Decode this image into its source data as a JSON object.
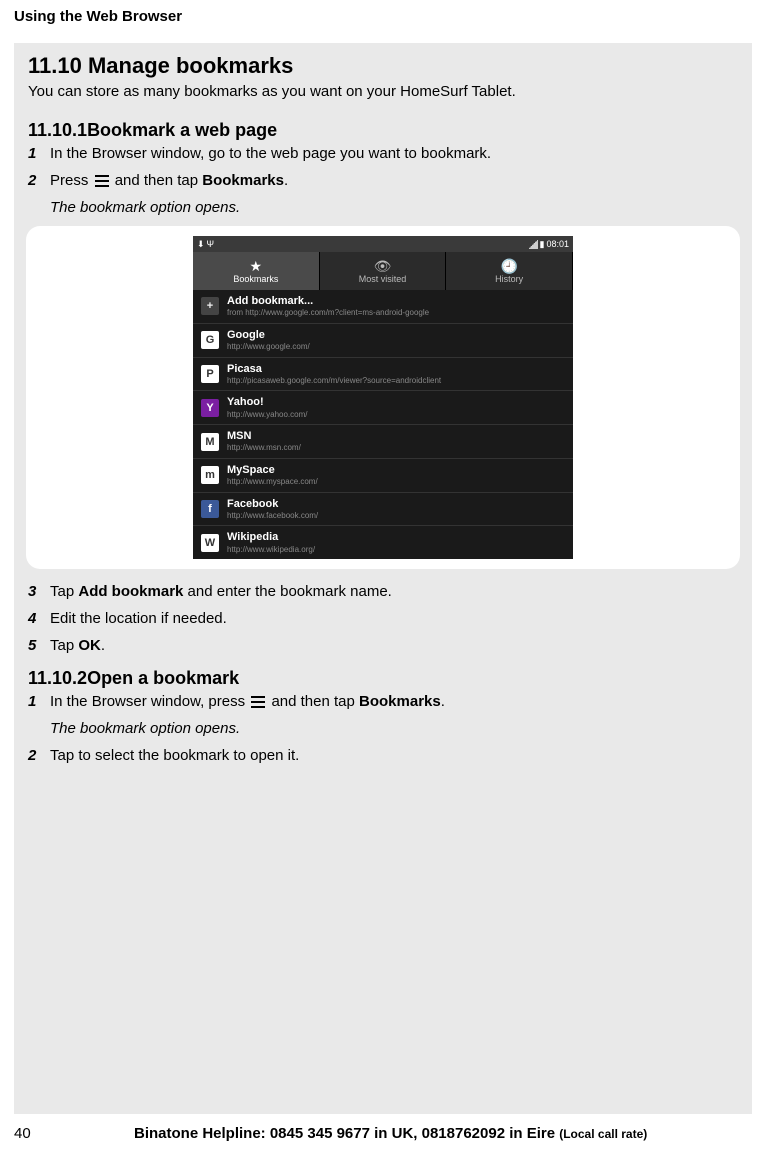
{
  "page_header": "Using the Web Browser",
  "section": {
    "number": "11.10",
    "title": "Manage bookmarks",
    "intro": "You can store as many bookmarks as you want on your HomeSurf Tablet."
  },
  "sub1": {
    "number": "11.10.1",
    "title": "Bookmark a web page",
    "steps": [
      {
        "num": "1",
        "text": "In the Browser window, go to the web page you want to bookmark."
      },
      {
        "num": "2",
        "pre": "Press ",
        "post": " and then tap ",
        "bold": "Bookmarks",
        "end": "."
      },
      {
        "num": "3",
        "pre": "Tap ",
        "bold": "Add bookmark",
        "post": " and enter the bookmark name."
      },
      {
        "num": "4",
        "text": "Edit the location if needed."
      },
      {
        "num": "5",
        "pre": "Tap ",
        "bold": "OK",
        "post": "."
      }
    ],
    "result": "The bookmark option opens."
  },
  "sub2": {
    "number": "11.10.2",
    "title": "Open a bookmark",
    "steps": [
      {
        "num": "1",
        "pre": "In the Browser window, press ",
        "post": " and then tap ",
        "bold": "Bookmarks",
        "end": "."
      },
      {
        "num": "2",
        "text": "Tap to select the bookmark to open it."
      }
    ],
    "result": "The bookmark option opens."
  },
  "screenshot": {
    "time": "08:01",
    "tabs": [
      {
        "label": "Bookmarks",
        "icon": "★"
      },
      {
        "label": "Most visited",
        "icon": "👁"
      },
      {
        "label": "History",
        "icon": "🕘"
      }
    ],
    "add_bookmark": {
      "title": "Add bookmark...",
      "url": "from http://www.google.com/m?client=ms-android-google"
    },
    "bookmarks": [
      {
        "title": "Google",
        "url": "http://www.google.com/",
        "letter": "G"
      },
      {
        "title": "Picasa",
        "url": "http://picasaweb.google.com/m/viewer?source=androidclient",
        "letter": "P"
      },
      {
        "title": "Yahoo!",
        "url": "http://www.yahoo.com/",
        "letter": "Y"
      },
      {
        "title": "MSN",
        "url": "http://www.msn.com/",
        "letter": "M"
      },
      {
        "title": "MySpace",
        "url": "http://www.myspace.com/",
        "letter": "m"
      },
      {
        "title": "Facebook",
        "url": "http://www.facebook.com/",
        "letter": "f"
      },
      {
        "title": "Wikipedia",
        "url": "http://www.wikipedia.org/",
        "letter": "W"
      }
    ]
  },
  "footer": {
    "page": "40",
    "helpline": "Binatone Helpline: 0845 345 9677 in UK, 0818762092 in Eire ",
    "rate": "(Local call rate)"
  }
}
